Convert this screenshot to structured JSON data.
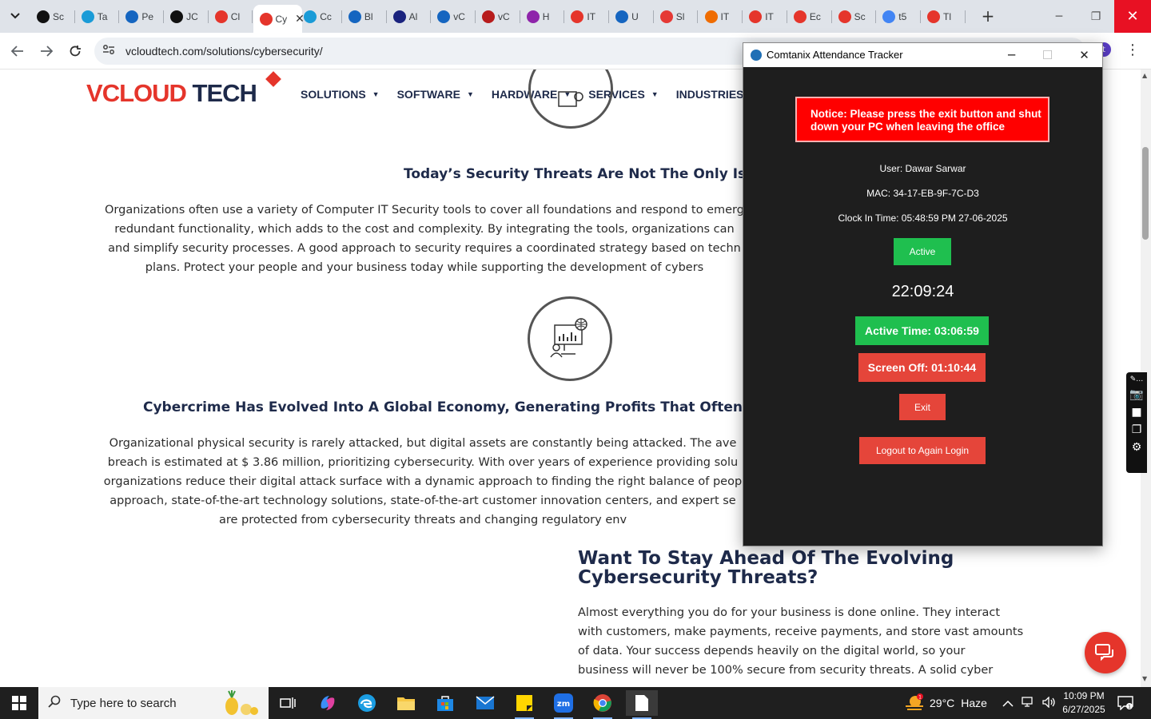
{
  "browser": {
    "tabs": [
      {
        "label": "Sc",
        "color": "#111111"
      },
      {
        "label": "Ta",
        "color": "#1a9bd7"
      },
      {
        "label": "Pe",
        "color": "#1565c0"
      },
      {
        "label": "JC",
        "color": "#111111"
      },
      {
        "label": "Cl",
        "color": "#e5352b"
      },
      {
        "label": "Cy",
        "color": "#e5352b",
        "active": true
      },
      {
        "label": "Cc",
        "color": "#1a9bd7"
      },
      {
        "label": "Bl",
        "color": "#1565c0"
      },
      {
        "label": "Al",
        "color": "#1a237e"
      },
      {
        "label": "vC",
        "color": "#1565c0"
      },
      {
        "label": "vC",
        "color": "#b71c1c"
      },
      {
        "label": "H",
        "color": "#8e24aa"
      },
      {
        "label": "IT",
        "color": "#e5352b"
      },
      {
        "label": "U",
        "color": "#1565c0"
      },
      {
        "label": "Sl",
        "color": "#e53935"
      },
      {
        "label": "IT",
        "color": "#ef6c00"
      },
      {
        "label": "IT",
        "color": "#e5352b"
      },
      {
        "label": "Ec",
        "color": "#e5352b"
      },
      {
        "label": "Sc",
        "color": "#e5352b"
      },
      {
        "label": "t5",
        "color": "#4285f4"
      },
      {
        "label": "Tl",
        "color": "#e5352b"
      }
    ],
    "url": "vcloudtech.com/solutions/cybersecurity/",
    "profile_initial": "t"
  },
  "site": {
    "logo": {
      "part1": "V",
      "part2": "CLOUD",
      "part3": " TECH"
    },
    "nav": [
      "SOLUTIONS",
      "SOFTWARE",
      "HARDWARE",
      "SERVICES",
      "INDUSTRIES"
    ],
    "section1": {
      "heading": "Today’s Security Threats Are Not The Only Issue",
      "lines": [
        "Organizations often use a variety of Computer IT Security tools to cover all foundations and respond to emerg",
        "redundant functionality, which adds to the cost and complexity. By integrating the tools, organizations can",
        "and simplify security processes. A good approach to security requires a coordinated strategy based on techn",
        "plans. Protect your people and your business today while supporting the development of cybers"
      ]
    },
    "section2": {
      "heading": "Cybercrime Has Evolved Into A Global Economy, Generating Profits That Often Exceed T",
      "lines": [
        "Organizational physical security is rarely attacked, but digital assets are constantly being attacked. The ave",
        "breach is estimated at $ 3.86 million, prioritizing cybersecurity. With over years of experience providing solu",
        "organizations reduce their digital attack surface with a dynamic approach to finding the right balance of peop",
        "approach, state-of-the-art technology solutions, state-of-the-art customer innovation centers, and expert se",
        "are protected from cybersecurity threats and changing regulatory env"
      ]
    },
    "section3": {
      "heading_line1": "Want To Stay Ahead Of The Evolving",
      "heading_line2": "Cybersecurity Threats?",
      "lines": [
        "Almost everything you do for your business is done online. They interact",
        "with customers, make payments, receive payments, and store vast amounts",
        "of data. Your success depends heavily on the digital world, so your",
        "business will never be 100% secure from security threats. A solid cyber"
      ]
    }
  },
  "tracker": {
    "title": "Comtanix Attendance Tracker",
    "notice_line1": "Notice: Please press the exit button and shut",
    "notice_line2": "down your PC when leaving the office",
    "user": "User: Dawar Sarwar",
    "mac": "MAC: 34-17-EB-9F-7C-D3",
    "clock_in": "Clock In Time: 05:48:59 PM 27-06-2025",
    "status_label": "Active",
    "clock": "22:09:24",
    "active_time": "Active Time: 03:06:59",
    "screen_off": "Screen Off: 01:10:44",
    "exit_label": "Exit",
    "logout_label": "Logout to Again Login",
    "colors": {
      "notice": "#ff0000",
      "green": "#1fbf4f",
      "red": "#e5453a",
      "bg": "#1e1e1e"
    }
  },
  "taskbar": {
    "search_placeholder": "Type here to search",
    "weather_temp": "29°C",
    "weather_desc": "Haze",
    "time": "10:09 PM",
    "date": "6/27/2025",
    "notification_count": "1"
  }
}
